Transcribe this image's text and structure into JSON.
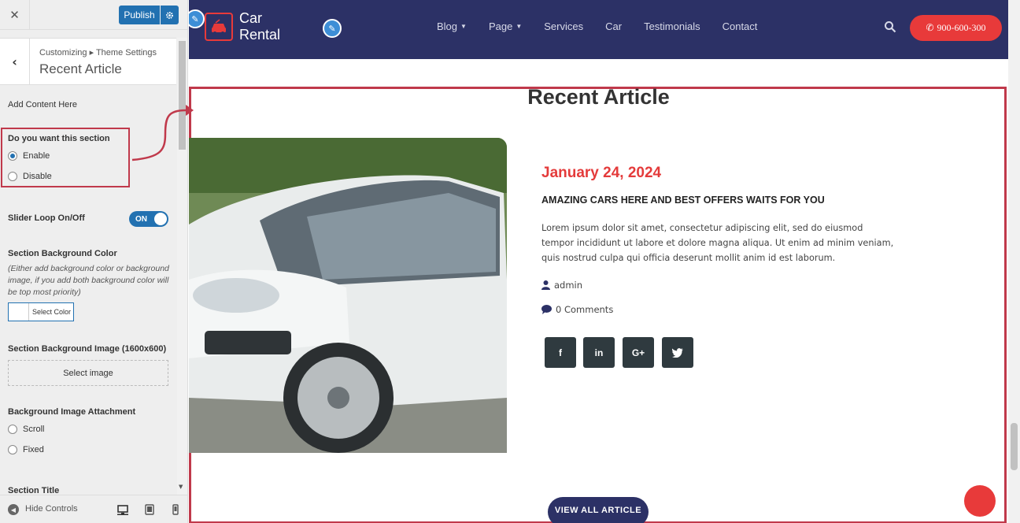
{
  "sidebar": {
    "publish_label": "Publish",
    "breadcrumb": "Customizing ▸ Theme Settings",
    "section_title": "Recent Article",
    "add_content": "Add Content Here",
    "section_toggle": {
      "label": "Do you want this section",
      "options": [
        "Enable",
        "Disable"
      ],
      "selected": "Enable"
    },
    "slider_loop": {
      "label": "Slider Loop On/Off",
      "state": "ON"
    },
    "bg_color": {
      "label": "Section Background Color",
      "description": "(Either add background color or background image, if you add both background color will be top most priority)",
      "button": "Select Color"
    },
    "bg_image": {
      "label": "Section Background Image (1600x600)",
      "button": "Select image"
    },
    "bg_attachment": {
      "label": "Background Image Attachment",
      "options": [
        "Scroll",
        "Fixed"
      ]
    },
    "next_section_label": "Section Title",
    "hide_controls": "Hide Controls"
  },
  "site": {
    "logo_line1": "Car",
    "logo_line2": "Rental",
    "nav": [
      "Blog",
      "Page",
      "Services",
      "Car",
      "Testimonials",
      "Contact"
    ],
    "phone": "900-600-300",
    "section_heading": "Recent Article",
    "article": {
      "date": "January 24, 2024",
      "title": "AMAZING CARS HERE AND BEST OFFERS WAITS FOR YOU",
      "body": "Lorem ipsum dolor sit amet, consectetur adipiscing elit, sed do eiusmod tempor incididunt ut labore et dolore magna aliqua. Ut enim ad minim veniam, quis nostrud culpa qui officia deserunt mollit anim id est laborum.",
      "author": "admin",
      "comments": "0 Comments",
      "social": [
        "f",
        "in",
        "G+",
        "t"
      ]
    },
    "view_all": "VIEW ALL ARTICLE"
  },
  "colors": {
    "header_bg": "#2c3166",
    "accent_red": "#e43b3b",
    "wp_blue": "#2271b1",
    "highlight_frame": "#c0394b"
  }
}
